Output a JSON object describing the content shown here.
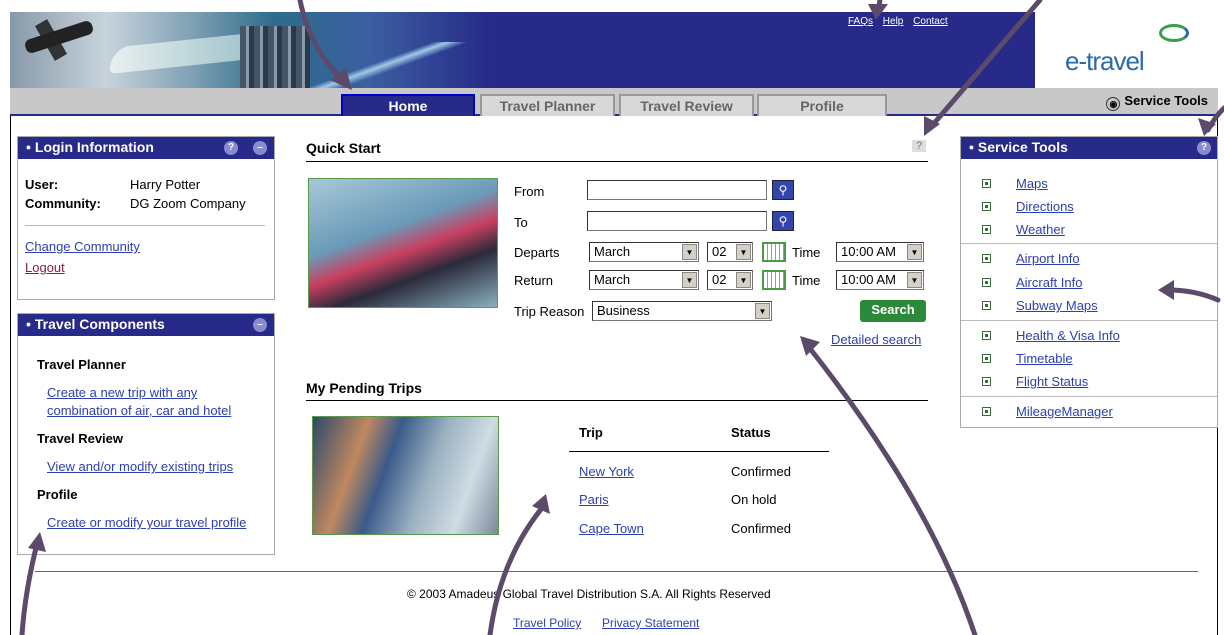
{
  "header": {
    "toplinks": [
      "FAQs",
      "Help",
      "Contact"
    ],
    "logo": "e-travel"
  },
  "nav": {
    "tabs": [
      "Home",
      "Travel Planner",
      "Travel Review",
      "Profile"
    ],
    "service_tools": "Service Tools"
  },
  "login": {
    "title": "Login Information",
    "user_label": "User:",
    "user": "Harry Potter",
    "community_label": "Community:",
    "community": "DG Zoom Company",
    "change": "Change Community",
    "logout": "Logout"
  },
  "components": {
    "title": "Travel Components",
    "planner": "Travel Planner",
    "planner_link1": "Create a new trip with any",
    "planner_link2": "combination of air, car and hotel",
    "review": "Travel Review",
    "review_link": "View and/or modify existing trips",
    "profile": "Profile",
    "profile_link": "Create or modify your travel profile"
  },
  "quick": {
    "title": "Quick Start",
    "help": "?",
    "from": "From",
    "to": "To",
    "departs": "Departs",
    "return": "Return",
    "time": "Time",
    "dep_month": "March",
    "dep_day": "02",
    "dep_time": "10:00 AM",
    "ret_month": "March",
    "ret_day": "02",
    "ret_time": "10:00 AM",
    "reason_label": "Trip Reason",
    "reason": "Business",
    "search": "Search",
    "detailed": "Detailed search"
  },
  "pending": {
    "title": "My Pending Trips",
    "col_trip": "Trip",
    "col_status": "Status",
    "rows": [
      {
        "trip": "New York",
        "status": "Confirmed"
      },
      {
        "trip": "Paris",
        "status": "On hold"
      },
      {
        "trip": "Cape Town",
        "status": "Confirmed"
      }
    ]
  },
  "service": {
    "title": "Service Tools",
    "help": "?",
    "groups": [
      [
        "Maps",
        "Directions",
        "Weather"
      ],
      [
        "Airport Info",
        "Aircraft Info",
        "Subway Maps"
      ],
      [
        "Health & Visa Info",
        "Timetable",
        "Flight Status"
      ],
      [
        "MileageManager"
      ]
    ]
  },
  "footer": {
    "copyright": "© 2003 Amadeus Global Travel Distribution S.A. All Rights Reserved",
    "policy": "Travel Policy",
    "privacy": "Privacy Statement"
  }
}
